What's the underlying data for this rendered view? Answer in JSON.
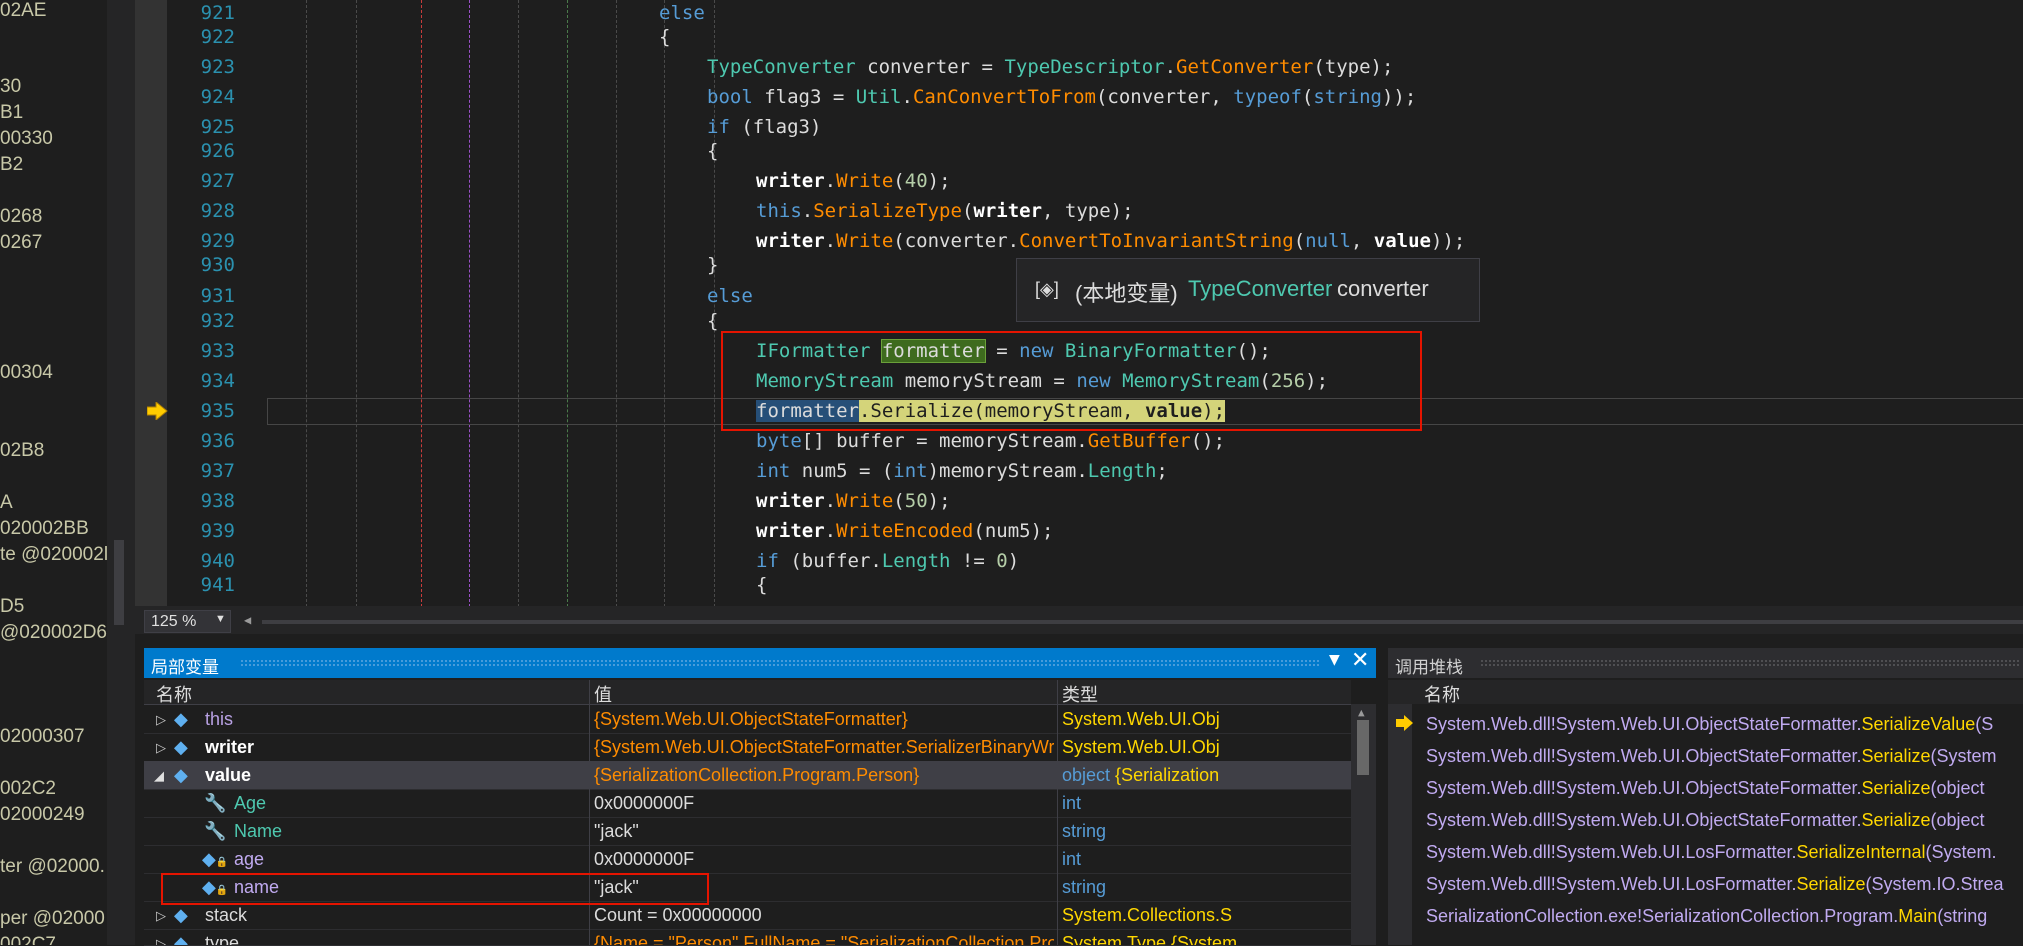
{
  "left_strip": [
    "02AE",
    "30",
    "B1",
    "00330",
    "B2",
    "0268",
    "0267",
    "00304",
    "02B8",
    "A",
    "020002BB",
    "te @020002l",
    "D5",
    "@020002D6",
    "02000307",
    "002C2",
    "02000249",
    "ter @02000.",
    "per @02000",
    "002C7"
  ],
  "code_lines": [
    {
      "n": "921"
    },
    {
      "n": "922"
    },
    {
      "n": "923"
    },
    {
      "n": "924"
    },
    {
      "n": "925"
    },
    {
      "n": "926"
    },
    {
      "n": "927"
    },
    {
      "n": "928"
    },
    {
      "n": "929"
    },
    {
      "n": "930"
    },
    {
      "n": "931"
    },
    {
      "n": "932"
    },
    {
      "n": "933"
    },
    {
      "n": "934"
    },
    {
      "n": "935"
    },
    {
      "n": "936"
    },
    {
      "n": "937"
    },
    {
      "n": "938"
    },
    {
      "n": "939"
    },
    {
      "n": "940"
    },
    {
      "n": "941"
    }
  ],
  "code": {
    "l921": "else",
    "l922": "{",
    "l923a": "TypeConverter",
    "l923b": " converter = ",
    "l923c": "TypeDescriptor",
    "l923d": ".",
    "l923e": "GetConverter",
    "l923f": "(type);",
    "l924a": "bool",
    "l924b": " flag3 = ",
    "l924c": "Util",
    "l924d": ".",
    "l924e": "CanConvertToFrom",
    "l924f": "(converter, ",
    "l924g": "typeof",
    "l924h": "(",
    "l924i": "string",
    "l924j": "));",
    "l925a": "if",
    "l925b": " (flag3)",
    "l926": "{",
    "l927a": "writer",
    "l927b": ".",
    "l927c": "Write",
    "l927d": "(",
    "l927e": "40",
    "l927f": ");",
    "l928a": "this",
    "l928b": ".",
    "l928c": "SerializeType",
    "l928d": "(",
    "l928e": "writer",
    "l928f": ", type);",
    "l929a": "writer",
    "l929b": ".",
    "l929c": "Write",
    "l929d": "(converter.",
    "l929e": "ConvertToInvariantString",
    "l929f": "(",
    "l929g": "null",
    "l929h": ", ",
    "l929i": "value",
    "l929j": "));",
    "l930": "}",
    "l931": "else",
    "l932": "{",
    "l933a": "IFormatter",
    "l933b": " ",
    "l933c": "formatter",
    "l933d": " = ",
    "l933e": "new",
    "l933f": " ",
    "l933g": "BinaryFormatter",
    "l933h": "();",
    "l934a": "MemoryStream",
    "l934b": " memoryStream = ",
    "l934c": "new",
    "l934d": " ",
    "l934e": "MemoryStream",
    "l934f": "(",
    "l934g": "256",
    "l934h": ");",
    "l935a": "formatter",
    "l935b": ".Serialize(memoryStream, ",
    "l935c": "value",
    "l935d": ");",
    "l936a": "byte",
    "l936b": "[] buffer = memoryStream.",
    "l936c": "GetBuffer",
    "l936d": "();",
    "l937a": "int",
    "l937b": " num5 = (",
    "l937c": "int",
    "l937d": ")memoryStream.",
    "l937e": "Length",
    "l937f": ";",
    "l938a": "writer",
    "l938b": ".",
    "l938c": "Write",
    "l938d": "(",
    "l938e": "50",
    "l938f": ");",
    "l939a": "writer",
    "l939b": ".",
    "l939c": "WriteEncoded",
    "l939d": "(num5);",
    "l940a": "if",
    "l940b": " (buffer.",
    "l940c": "Length",
    "l940d": " != ",
    "l940e": "0",
    "l940f": ")",
    "l941": "{"
  },
  "tooltip": {
    "icon": "[◈]",
    "prefix": "(本地变量)",
    "type": "TypeConverter",
    "name": "converter"
  },
  "zoom": {
    "value": "125 %"
  },
  "locals": {
    "title": "局部变量",
    "col_name": "名称",
    "col_value": "值",
    "col_type": "类型",
    "rows": [
      {
        "name": "this",
        "value": "{System.Web.UI.ObjectStateFormatter}",
        "type": "System.Web.UI.Obj"
      },
      {
        "name": "writer",
        "value": "{System.Web.UI.ObjectStateFormatter.SerializerBinaryWriter}",
        "type": "System.Web.UI.Obj"
      },
      {
        "name": "value",
        "value": "{SerializationCollection.Program.Person}",
        "type_a": "object",
        "type_b": " {Serialization"
      },
      {
        "name": "Age",
        "value": "0x0000000F",
        "type": "int"
      },
      {
        "name": "Name",
        "value": "\"jack\"",
        "type": "string"
      },
      {
        "name": "age",
        "value": "0x0000000F",
        "type": "int"
      },
      {
        "name": "name",
        "value": "\"jack\"",
        "type": "string"
      },
      {
        "name": "stack",
        "value": "Count = 0x00000000",
        "type": "System.Collections.S"
      },
      {
        "name": "type",
        "value": "{Name = \"Person\" FullName = \"SerializationCollection.Program+P",
        "type": "System.Type {System"
      }
    ]
  },
  "callstack": {
    "title": "调用堆栈",
    "col_name": "名称",
    "rows": [
      {
        "a": "System.Web.dll!",
        "b": "System.Web.UI.ObjectStateFormatter.",
        "c": "SerializeValue",
        "d": "(S"
      },
      {
        "a": "System.Web.dll!",
        "b": "System.Web.UI.ObjectStateFormatter.",
        "c": "Serialize",
        "d": "(System"
      },
      {
        "a": "System.Web.dll!",
        "b": "System.Web.UI.ObjectStateFormatter.",
        "c": "Serialize",
        "d": "(object"
      },
      {
        "a": "System.Web.dll!",
        "b": "System.Web.UI.ObjectStateFormatter.",
        "c": "Serialize",
        "d": "(object"
      },
      {
        "a": "System.Web.dll!",
        "b": "System.Web.UI.LosFormatter.",
        "c": "SerializeInternal",
        "d": "(System."
      },
      {
        "a": "System.Web.dll!",
        "b": "System.Web.UI.LosFormatter.",
        "c": "Serialize",
        "d": "(System.IO.Strea"
      },
      {
        "a": "SerializationCollection.exe!",
        "b": "SerializationCollection.Program.",
        "c": "Main",
        "d": "(string"
      }
    ]
  }
}
